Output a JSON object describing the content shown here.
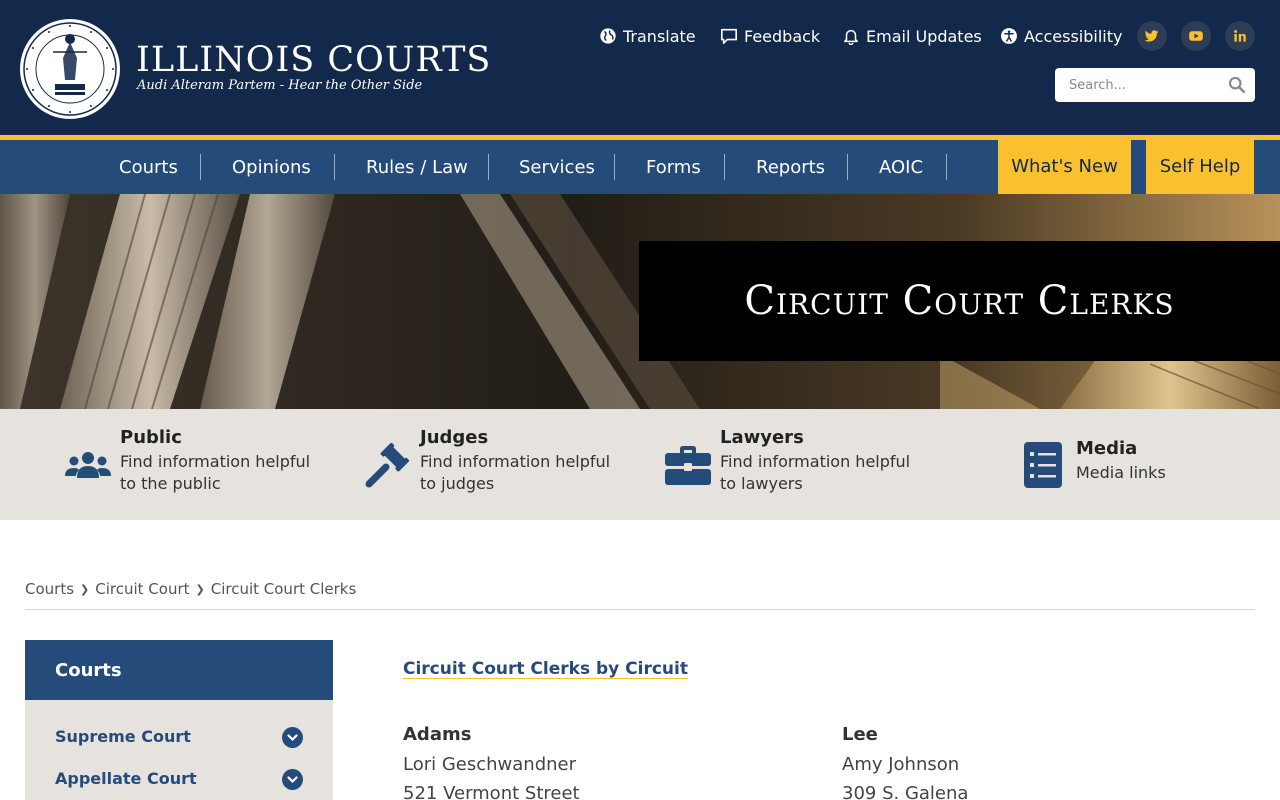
{
  "brand": {
    "title": "ILLINOIS COURTS",
    "subtitle": "Audi Alteram Partem - Hear the Other Side",
    "seal_text_top": "SEAL OF THE SUPREME COURT",
    "seal_text_inner": "STATE OF ILLINOIS",
    "seal_text_date": "AUG. 26, 1818"
  },
  "utility": {
    "translate": "Translate",
    "feedback": "Feedback",
    "email_updates": "Email Updates",
    "accessibility": "Accessibility"
  },
  "social": [
    "twitter-icon",
    "youtube-icon",
    "linkedin-icon"
  ],
  "search": {
    "placeholder": "Search..."
  },
  "nav": {
    "items": [
      "Courts",
      "Opinions",
      "Rules / Law",
      "Services",
      "Forms",
      "Reports",
      "AOIC"
    ],
    "whats_new": "What's New",
    "self_help": "Self Help"
  },
  "hero": {
    "title": "Circuit Court Clerks"
  },
  "audience": [
    {
      "title": "Public",
      "desc": "Find information helpful to the public",
      "icon": "users-icon"
    },
    {
      "title": "Judges",
      "desc": "Find information helpful to judges",
      "icon": "gavel-icon"
    },
    {
      "title": "Lawyers",
      "desc": "Find information helpful to lawyers",
      "icon": "briefcase-icon"
    },
    {
      "title": "Media",
      "desc": "Media links",
      "icon": "list-icon"
    }
  ],
  "breadcrumb": [
    "Courts",
    "Circuit Court",
    "Circuit Court Clerks"
  ],
  "sidebar": {
    "heading": "Courts",
    "items": [
      "Supreme Court",
      "Appellate Court"
    ]
  },
  "main": {
    "link": "Circuit Court Clerks by Circuit",
    "counties": [
      {
        "name": "Adams",
        "clerk": "Lori Geschwandner",
        "address": "521 Vermont Street"
      },
      {
        "name": "Lee",
        "clerk": "Amy Johnson",
        "address": "309 S. Galena"
      }
    ]
  },
  "colors": {
    "navy": "#13294b",
    "blue": "#254b7a",
    "gold": "#fbc02d",
    "light_gray": "#e6e3df"
  }
}
